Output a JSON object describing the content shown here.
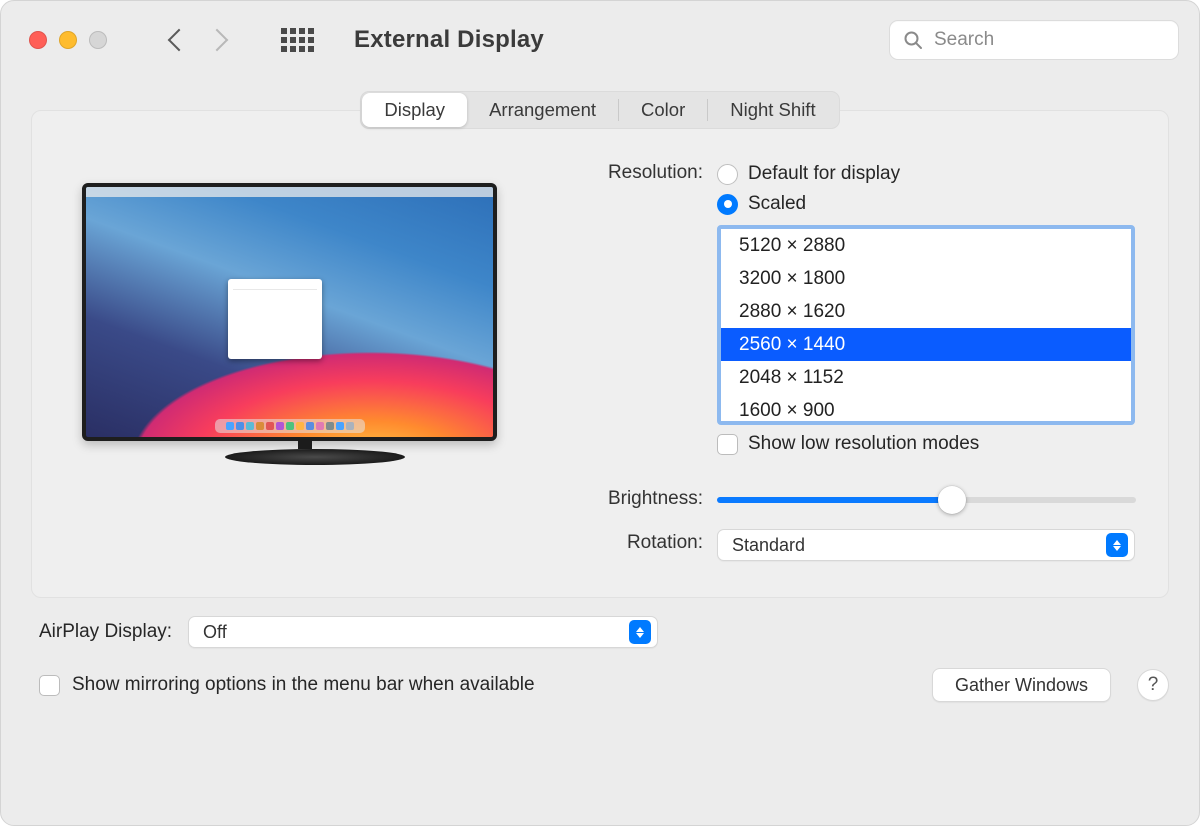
{
  "window": {
    "title": "External Display"
  },
  "search": {
    "placeholder": "Search",
    "value": ""
  },
  "tabs": [
    "Display",
    "Arrangement",
    "Color",
    "Night Shift"
  ],
  "active_tab": "Display",
  "resolution": {
    "label": "Resolution:",
    "default_label": "Default for display",
    "scaled_label": "Scaled",
    "selected_mode": "scaled",
    "options": [
      "5120 × 2880",
      "3200 × 1800",
      "2880 × 1620",
      "2560 × 1440",
      "2048 × 1152",
      "1600 × 900"
    ],
    "selected_option": "2560 × 1440",
    "low_res_label": "Show low resolution modes",
    "low_res_checked": false
  },
  "brightness": {
    "label": "Brightness:",
    "value_pct": 56
  },
  "rotation": {
    "label": "Rotation:",
    "value": "Standard"
  },
  "airplay": {
    "label": "AirPlay Display:",
    "value": "Off"
  },
  "mirroring": {
    "label": "Show mirroring options in the menu bar when available",
    "checked": false
  },
  "gather_label": "Gather Windows",
  "help_label": "?",
  "colors": {
    "accent": "#007aff",
    "selection": "#0a5cff"
  }
}
